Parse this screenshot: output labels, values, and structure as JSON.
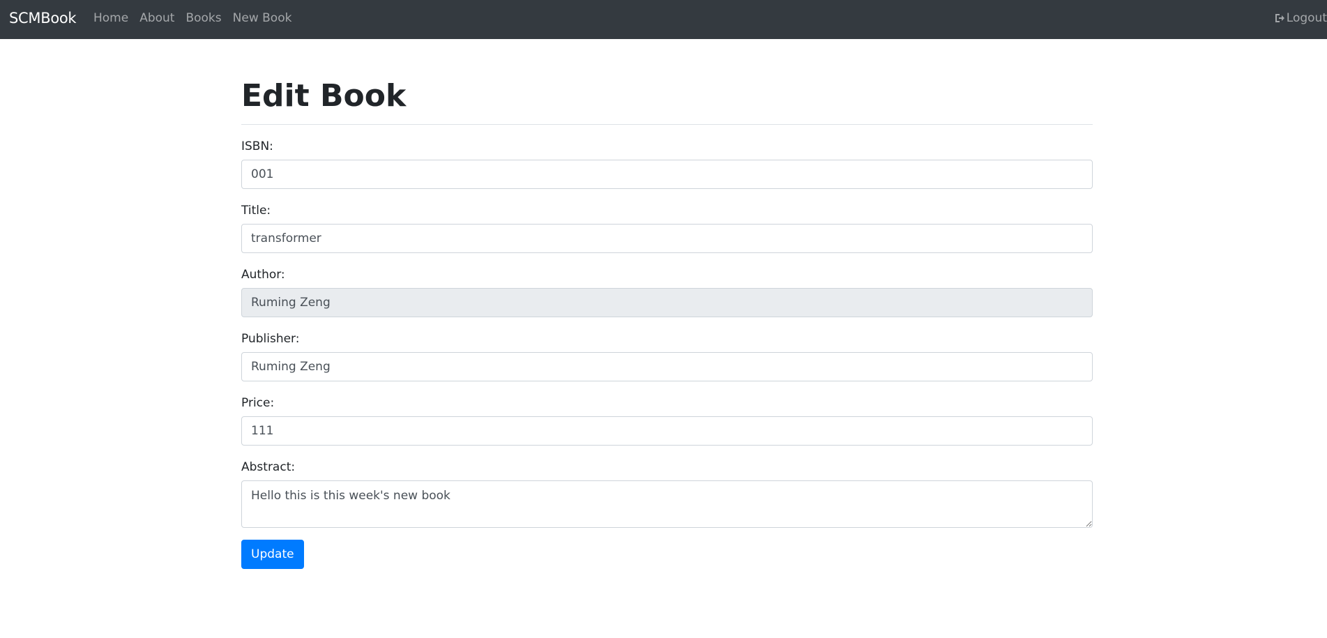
{
  "navbar": {
    "brand": "SCMBook",
    "links": [
      "Home",
      "About",
      "Books",
      "New Book"
    ],
    "logout_label": "Logout",
    "logout_icon": "sign-out-icon",
    "background": "#343a40"
  },
  "page": {
    "title": "Edit Book"
  },
  "form": {
    "isbn": {
      "label": "ISBN:",
      "value": "001"
    },
    "title": {
      "label": "Title:",
      "value": "transformer"
    },
    "author": {
      "label": "Author:",
      "value": "Ruming Zeng",
      "readonly": true
    },
    "publisher": {
      "label": "Publisher:",
      "value": "Ruming Zeng"
    },
    "price": {
      "label": "Price:",
      "value": "111"
    },
    "abstract": {
      "label": "Abstract:",
      "value": "Hello this is this week's new book"
    },
    "submit_label": "Update",
    "submit_color": "#007bff"
  }
}
